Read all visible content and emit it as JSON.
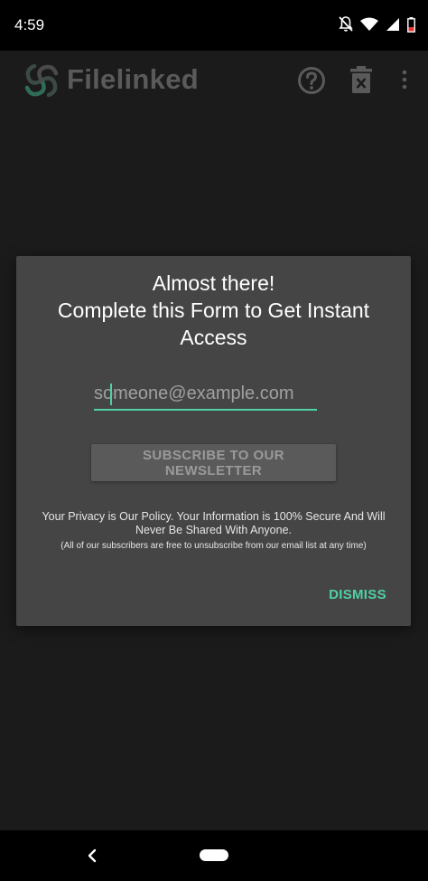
{
  "status_bar": {
    "time": "4:59",
    "icons": [
      "notifications-off-icon",
      "wifi-icon",
      "signal-icon",
      "battery-low-icon"
    ]
  },
  "app_bar": {
    "title": "Filelinked",
    "icons": [
      "logo-icon",
      "help-icon",
      "trash-icon",
      "overflow-menu-icon"
    ]
  },
  "dialog": {
    "title_line1": "Almost there!",
    "title_line2": "Complete this Form to Get Instant",
    "title_line3": "Access",
    "email_placeholder": "someone@example.com",
    "email_value": "",
    "subscribe_label": "SUBSCRIBE TO OUR NEWSLETTER",
    "privacy_line1": "Your Privacy is Our Policy. Your Information is 100% Secure And Will",
    "privacy_line2": "Never Be Shared With Anyone.",
    "unsubscribe_note": "(All of our subscribers are free to unsubscribe from our email list at any time)",
    "dismiss_label": "DISMISS"
  },
  "nav_bar": {
    "icons": [
      "back-icon",
      "home-pill-icon"
    ]
  },
  "colors": {
    "accent": "#4fd1a5",
    "dialog_bg": "#454545",
    "screen_bg": "#1b1b1b"
  }
}
